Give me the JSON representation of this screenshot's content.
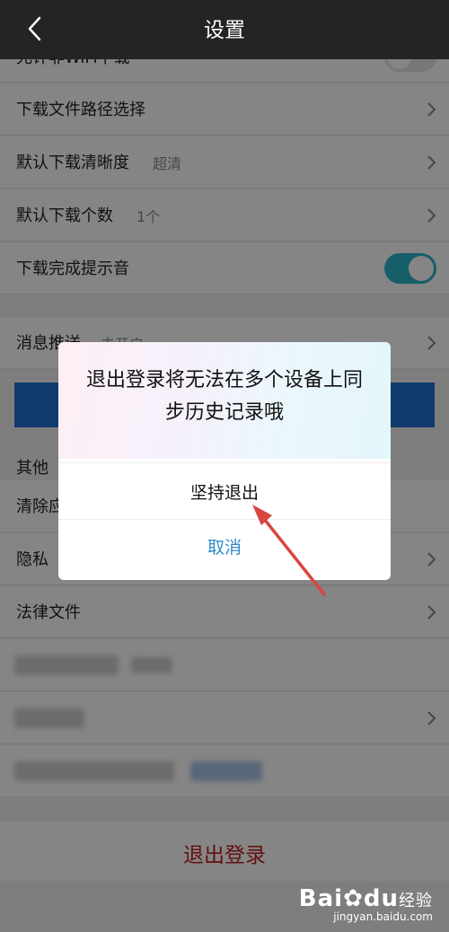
{
  "header": {
    "title": "设置"
  },
  "rows": {
    "wifi": {
      "label": "允许非WiFi下载"
    },
    "path": {
      "label": "下载文件路径选择"
    },
    "quality": {
      "label": "默认下载清晰度",
      "value": "超清"
    },
    "count": {
      "label": "默认下载个数",
      "value": "1个"
    },
    "sound": {
      "label": "下载完成提示音"
    },
    "push": {
      "label": "消息推送",
      "value": "未开启"
    }
  },
  "other": {
    "section_title": "其他",
    "clear": {
      "label": "清除应用缓存"
    },
    "privacy": {
      "label": "隐私"
    },
    "legal": {
      "label": "法律文件"
    }
  },
  "logout": {
    "label": "退出登录"
  },
  "dialog": {
    "message": "退出登录将无法在多个设备上同步历史记录哦",
    "confirm": "坚持退出",
    "cancel": "取消"
  },
  "watermark": {
    "brand": "Bai",
    "brand2": "du",
    "sub": "经验",
    "url": "jingyan.baidu.com"
  },
  "colors": {
    "accent": "#2bb6c9",
    "logout": "#c21f1f",
    "cancel": "#2f8ac9",
    "arrow": "#d9453f"
  }
}
